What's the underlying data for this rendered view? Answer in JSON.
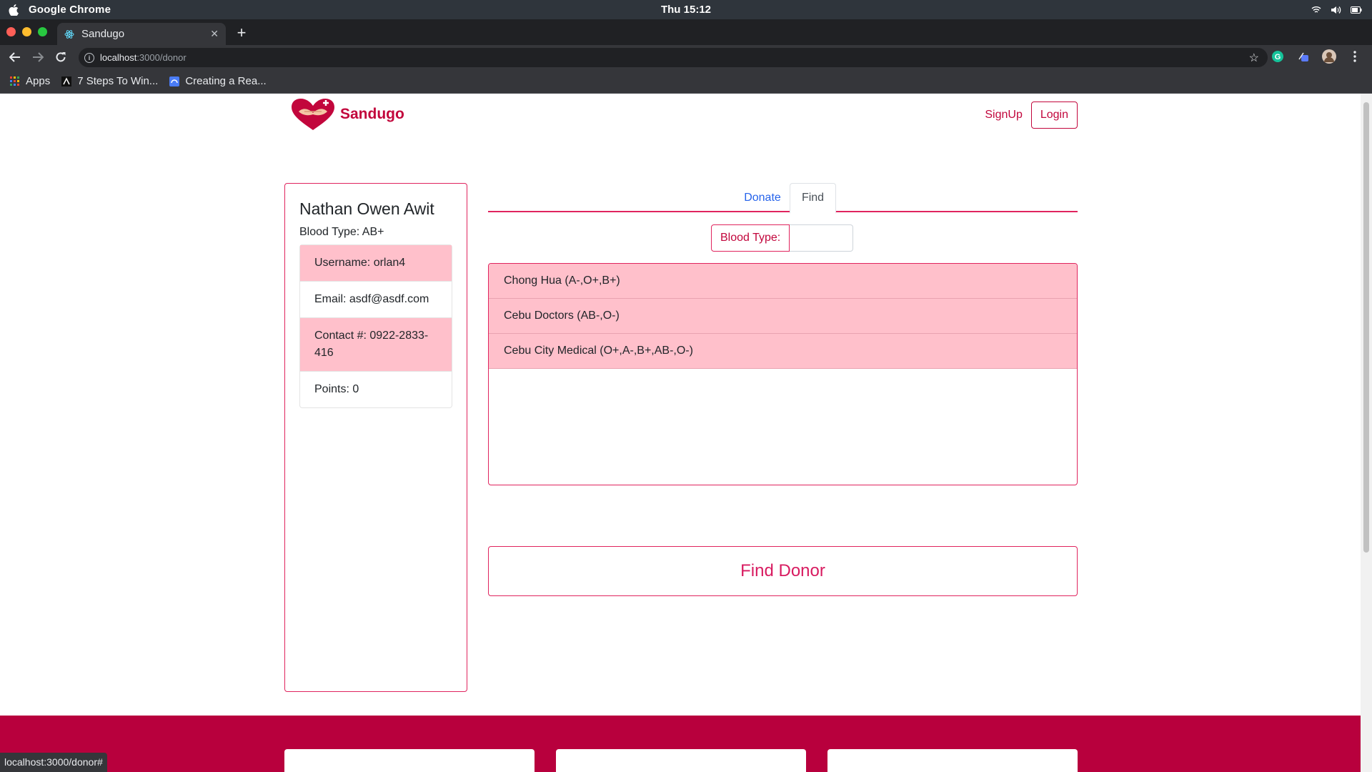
{
  "os": {
    "app_name": "Google Chrome",
    "clock": "Thu 15:12"
  },
  "browser": {
    "tab_title": "Sandugo",
    "url_host": "localhost",
    "url_path": ":3000/donor",
    "bookmarks": [
      {
        "label": "Apps",
        "icon": "apps-grid-icon"
      },
      {
        "label": "7 Steps To Win...",
        "icon": "bookmark-a-icon"
      },
      {
        "label": "Creating a Rea...",
        "icon": "bookmark-doc-icon"
      }
    ],
    "status_url": "localhost:3000/donor#"
  },
  "header": {
    "brand_name": "Sandugo",
    "signup_label": "SignUp",
    "login_label": "Login"
  },
  "profile": {
    "name": "Nathan Owen Awit",
    "blood_type": "Blood Type: AB+",
    "username": "Username: orlan4",
    "email": "Email: asdf@asdf.com",
    "contact": "Contact #: 0922-2833-416",
    "points": "Points: 0"
  },
  "tabs": {
    "donate": "Donate",
    "find": "Find"
  },
  "search": {
    "blood_type_label": "Blood Type:",
    "blood_type_value": ""
  },
  "hospitals": [
    "Chong Hua (A-,O+,B+)",
    "Cebu Doctors (AB-,O-)",
    "Cebu City Medical (O+,A-,B+,AB-,O-)"
  ],
  "find_donor_label": "Find Donor",
  "colors": {
    "brand": "#c2063c",
    "row_pink": "#ffc0cb",
    "footer": "#b8003d"
  }
}
